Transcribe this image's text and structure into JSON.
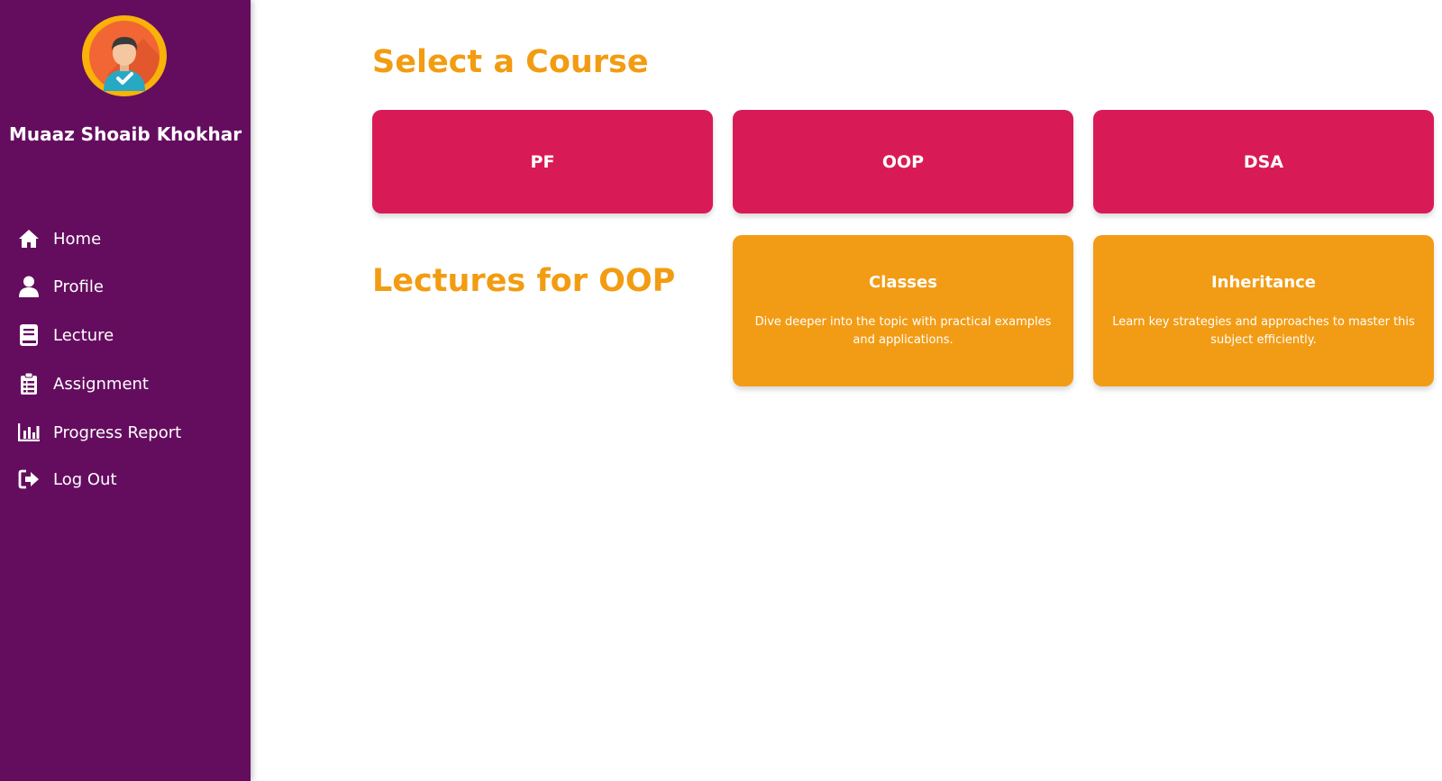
{
  "user": {
    "name": "Muaaz Shoaib Khokhar",
    "avatar_icon": "user-avatar-icon"
  },
  "sidebar": {
    "items": [
      {
        "label": "Home",
        "icon": "home-icon"
      },
      {
        "label": "Profile",
        "icon": "user-icon"
      },
      {
        "label": "Lecture",
        "icon": "book-icon"
      },
      {
        "label": "Assignment",
        "icon": "clipboard-icon"
      },
      {
        "label": "Progress Report",
        "icon": "bar-chart-icon"
      },
      {
        "label": "Log Out",
        "icon": "logout-icon"
      }
    ]
  },
  "main": {
    "select_title": "Select a Course",
    "courses": [
      {
        "label": "PF"
      },
      {
        "label": "OOP"
      },
      {
        "label": "DSA"
      }
    ],
    "lectures_title": "Lectures for OOP",
    "lectures": [
      {
        "title": "Classes",
        "description": "Dive deeper into the topic with practical examples and applications."
      },
      {
        "title": "Inheritance",
        "description": "Learn key strategies and approaches to master this subject efficiently."
      }
    ]
  },
  "colors": {
    "sidebar_bg": "#640d5f",
    "heading": "#f29c11",
    "course_card": "#d81b57",
    "lecture_card": "#f29c15",
    "text_light": "#ffffff"
  }
}
